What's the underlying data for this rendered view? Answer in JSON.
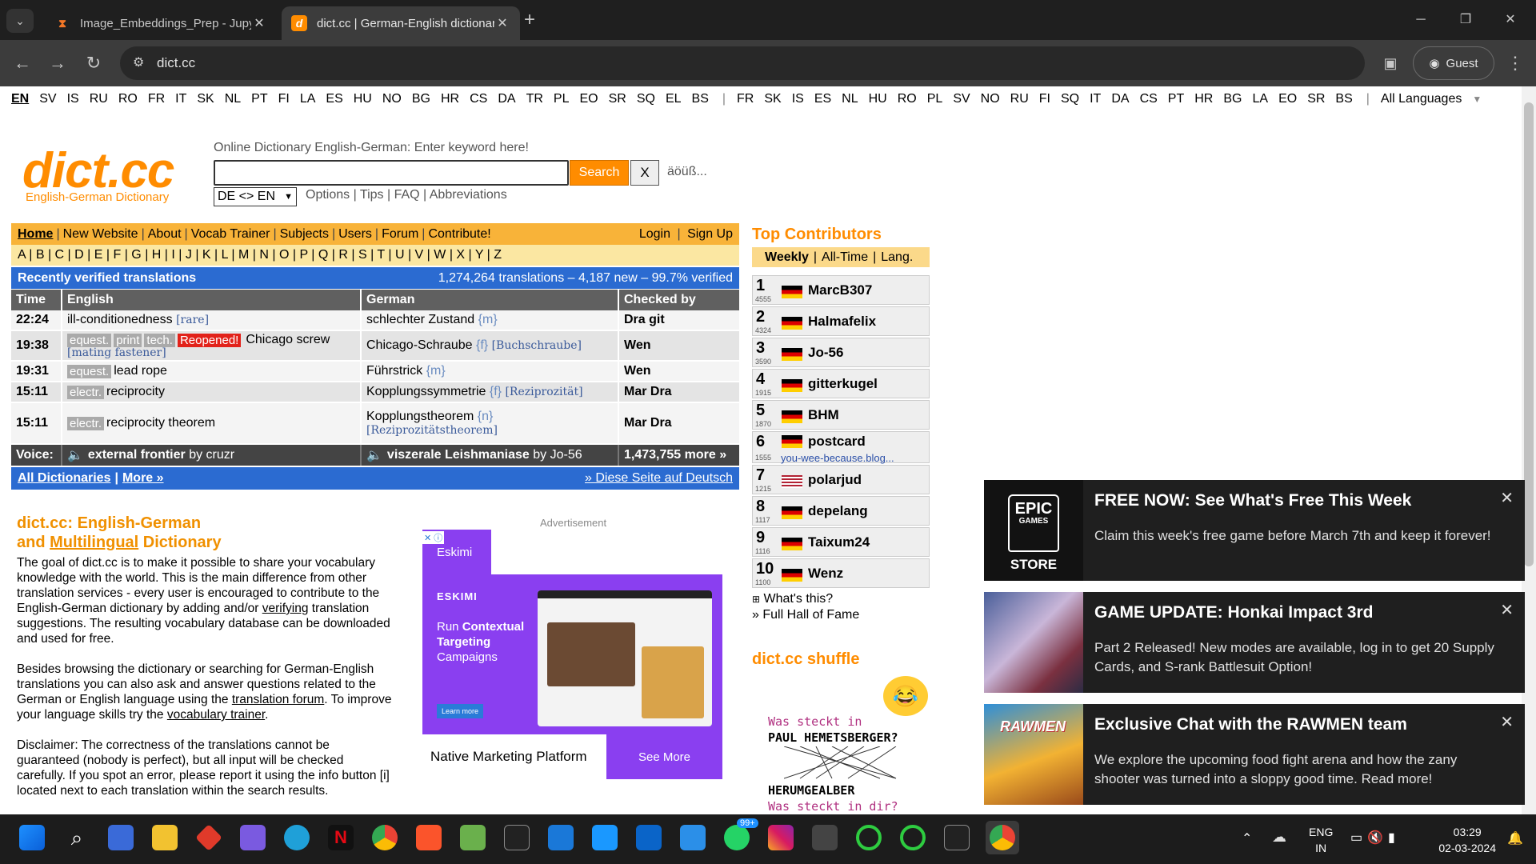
{
  "browser": {
    "tabs": [
      {
        "title": "Image_Embeddings_Prep - Jupyter",
        "active": false,
        "icon": "jupyter-icon"
      },
      {
        "title": "dict.cc | German-English dictionary",
        "active": true,
        "icon": "dictcc-icon"
      }
    ],
    "url": "dict.cc",
    "profile": "Guest"
  },
  "languages_left": [
    "EN",
    "SV",
    "IS",
    "RU",
    "RO",
    "FR",
    "IT",
    "SK",
    "NL",
    "PT",
    "FI",
    "LA",
    "ES",
    "HU",
    "NO",
    "BG",
    "HR",
    "CS",
    "DA",
    "TR",
    "PL",
    "EO",
    "SR",
    "SQ",
    "EL",
    "BS"
  ],
  "languages_right": [
    "FR",
    "SK",
    "IS",
    "ES",
    "NL",
    "HU",
    "RO",
    "PL",
    "SV",
    "NO",
    "RU",
    "FI",
    "SQ",
    "IT",
    "DA",
    "CS",
    "PT",
    "HR",
    "BG",
    "LA",
    "EO",
    "SR",
    "BS"
  ],
  "all_languages": "All Languages",
  "logo": {
    "text": "dict.cc",
    "subtitle": "English-German Dictionary"
  },
  "search": {
    "hint": "Online Dictionary English-German: Enter keyword here!",
    "button": "Search",
    "clear": "X",
    "special_chars": "äöüß...",
    "direction": "DE <> EN",
    "links": "Options | Tips | FAQ | Abbreviations"
  },
  "nav": {
    "items": [
      "Home",
      "New Website",
      "About",
      "Vocab Trainer",
      "Subjects",
      "Users",
      "Forum",
      "Contribute!"
    ],
    "login": "Login",
    "signup": "Sign Up"
  },
  "alphabet": "A | B | C | D | E | F | G | H | I | J | K | L | M | N | O | P | Q | R | S | T | U | V | W | X | Y | Z",
  "recent": {
    "title": "Recently verified translations",
    "stats": "1,274,264 translations – 4,187 new – 99.7% verified",
    "headers": {
      "time": "Time",
      "english": "English",
      "german": "German",
      "checked": "Checked by"
    },
    "rows": [
      {
        "time": "22:24",
        "tags": [],
        "reopened": "",
        "english": "ill-conditionedness",
        "en_gram": "[rare]",
        "en_gram2": "",
        "german": "schlechter Zustand",
        "de_gram": "{m}",
        "de_gram2": "",
        "checked": "Dra git"
      },
      {
        "time": "19:38",
        "tags": [
          "equest.",
          "print",
          "tech."
        ],
        "reopened": "Reopened!",
        "english": "Chicago screw",
        "en_gram": "",
        "en_gram2": "[mating fastener]",
        "german": "Chicago-Schraube",
        "de_gram": "{f}",
        "de_gram2": "[Buchschraube]",
        "checked": "Wen"
      },
      {
        "time": "19:31",
        "tags": [
          "equest."
        ],
        "reopened": "",
        "english": "lead rope",
        "en_gram": "",
        "en_gram2": "",
        "german": "Führstrick",
        "de_gram": "{m}",
        "de_gram2": "",
        "checked": "Wen"
      },
      {
        "time": "15:11",
        "tags": [
          "electr."
        ],
        "reopened": "",
        "english": "reciprocity",
        "en_gram": "",
        "en_gram2": "",
        "german": "Kopplungssymmetrie",
        "de_gram": "{f}",
        "de_gram2": "[Reziprozität]",
        "checked": "Mar Dra"
      },
      {
        "time": "15:11",
        "tags": [
          "electr."
        ],
        "reopened": "",
        "english": "reciprocity theorem",
        "en_gram": "",
        "en_gram2": "",
        "german": "Kopplungstheorem",
        "de_gram": "{n}",
        "de_gram2": "[Reziprozitätstheorem]",
        "checked": "Mar Dra"
      }
    ],
    "voice": {
      "label": "Voice:",
      "en": "external frontier",
      "en_by": "by cruzr",
      "de": "viszerale Leishmaniase",
      "de_by": "by Jo-56",
      "more": "1,473,755 more »"
    },
    "all_dicts": "All Dictionaries",
    "more": "More »",
    "german_site": "» Diese Seite auf Deutsch"
  },
  "intro": {
    "title1": "dict.cc: English-German",
    "title2_pre": "and ",
    "title2_link": "Multilingual",
    "title2_post": " Dictionary",
    "p1_a": "The goal of dict.cc is to make it possible to share your vocabulary knowledge with the world. This is the main difference from other translation services - every user is encouraged to contribute to the English-German dictionary by adding and/or ",
    "p1_link": "verifying",
    "p1_b": " translation suggestions. The resulting vocabulary database can be downloaded and used for free.",
    "p2_a": "Besides browsing the dictionary or searching for German-English translations you can also ask and answer questions related to the German or English language using the ",
    "p2_link1": "translation forum",
    "p2_b": ". To improve your language skills try the ",
    "p2_link2": "vocabulary trainer",
    "p2_c": ".",
    "p3": "Disclaimer: The correctness of the translations cannot be guaranteed (nobody is perfect), but all input will be checked carefully. If you spot an error, please report it using the info button [i] located next to each translation within the search results."
  },
  "ad": {
    "label": "Advertisement",
    "brand": "Eskimi",
    "logo": "ESKIMI",
    "headline_pre": "Run ",
    "headline_bold": "Contextual Targeting",
    "headline_post": " Campaigns",
    "learn": "Learn more",
    "footer": "Native Marketing Platform",
    "cta": "See More"
  },
  "contributors": {
    "title": "Top Contributors",
    "tabs": [
      "Weekly",
      "All-Time",
      "Lang."
    ],
    "list": [
      {
        "rank": "1",
        "count": "4555",
        "name": "MarcB307",
        "flag": "de",
        "sub": ""
      },
      {
        "rank": "2",
        "count": "4324",
        "name": "Halmafelix",
        "flag": "de",
        "sub": ""
      },
      {
        "rank": "3",
        "count": "3590",
        "name": "Jo-56",
        "flag": "de",
        "sub": ""
      },
      {
        "rank": "4",
        "count": "1915",
        "name": "gitterkugel",
        "flag": "de",
        "sub": ""
      },
      {
        "rank": "5",
        "count": "1870",
        "name": "BHM",
        "flag": "de",
        "sub": ""
      },
      {
        "rank": "6",
        "count": "1555",
        "name": "postcard",
        "flag": "de",
        "sub": "you-wee-because.blog..."
      },
      {
        "rank": "7",
        "count": "1215",
        "name": "polarjud",
        "flag": "us",
        "sub": ""
      },
      {
        "rank": "8",
        "count": "1117",
        "name": "depelang",
        "flag": "de",
        "sub": ""
      },
      {
        "rank": "9",
        "count": "1116",
        "name": "Taixum24",
        "flag": "de",
        "sub": ""
      },
      {
        "rank": "10",
        "count": "1100",
        "name": "Wenz",
        "flag": "de",
        "sub": ""
      }
    ],
    "whats_this": "What's this?",
    "hall_of_fame": "» Full Hall of Fame"
  },
  "shuffle": {
    "title": "dict.cc shuffle",
    "line1": "Was steckt in",
    "line2": "PAUL HEMETSBERGER?",
    "line3": "HERUMGEALBER",
    "line4": "Was steckt in dir?"
  },
  "notifications": [
    {
      "title": "FREE NOW: See What's Free This Week",
      "body": "Claim this week's free game before March 7th and keep it forever!",
      "image": "EPIC GAMES STORE",
      "img_top": "EPIC",
      "img_mid": "GAMES",
      "img_bot": "STORE"
    },
    {
      "title": "GAME UPDATE: Honkai Impact 3rd",
      "body": "Part 2 Released! New modes are available, log in to get 20 Supply Cards, and S-rank Battlesuit Option!",
      "image": "honkai-art"
    },
    {
      "title": "Exclusive Chat with the RAWMEN team",
      "body": "We explore the upcoming food fight arena and how the zany shooter was turned into a sloppy good time. Read more!",
      "image": "RAWMEN"
    }
  ],
  "taskbar": {
    "lang1": "ENG",
    "lang2": "IN",
    "time": "03:29",
    "date": "02-03-2024",
    "badge": "99+"
  },
  "colors": {
    "accent": "#ff8c00",
    "nav": "#f8b339",
    "blue": "#2b6bd1"
  }
}
